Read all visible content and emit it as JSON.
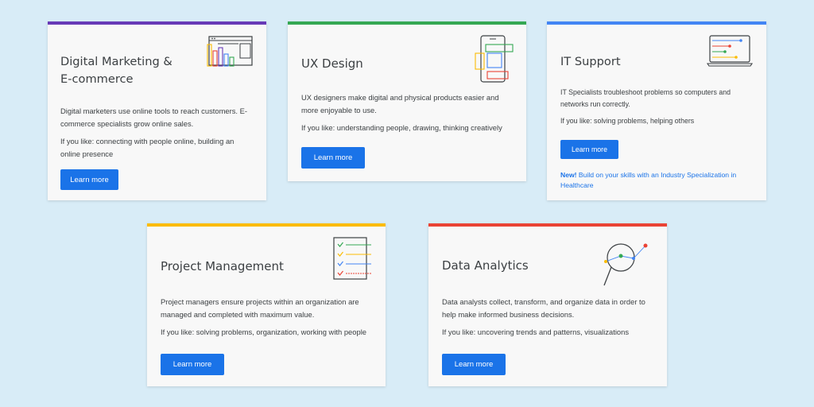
{
  "cards": [
    {
      "title": "Digital Marketing &\nE-commerce",
      "description": "Digital marketers use online tools to reach customers. E-commerce specialists grow online sales.",
      "if_you_like": "If you like: connecting with people online, building an online presence",
      "button": "Learn more",
      "accent": "#673ab7",
      "icon": "browser-window-bar-chart-icon"
    },
    {
      "title": "UX Design",
      "description": "UX designers make digital and physical products easier and more enjoyable to use.",
      "if_you_like": "If you like: understanding people, drawing, thinking creatively",
      "button": "Learn more",
      "accent": "#34a853",
      "icon": "phone-wireframe-icon"
    },
    {
      "title": "IT Support",
      "description": "IT Specialists troubleshoot problems so computers and networks run correctly.",
      "if_you_like": "If you like: solving problems, helping others",
      "button": "Learn more",
      "accent": "#4285f4",
      "icon": "laptop-icon",
      "note_new": "New!",
      "note_text": " Build on your skills with an Industry Specialization in Healthcare"
    },
    {
      "title": "Project Management",
      "description": "Project managers ensure projects within an organization are managed and completed with maximum value.",
      "if_you_like": "If you like: solving problems, organization, working with people",
      "button": "Learn more",
      "accent": "#fbbc04",
      "icon": "checklist-icon"
    },
    {
      "title": "Data Analytics",
      "description": "Data analysts collect, transform, and organize data in order to help make informed business decisions.",
      "if_you_like": "If you like: uncovering trends and patterns, visualizations",
      "button": "Learn more",
      "accent": "#ea4335",
      "icon": "magnifying-glass-data-icon"
    }
  ],
  "colors": {
    "background": "#d8ecf7",
    "card": "#f8f8f8",
    "button": "#1a73e8",
    "text": "#3c4043"
  }
}
